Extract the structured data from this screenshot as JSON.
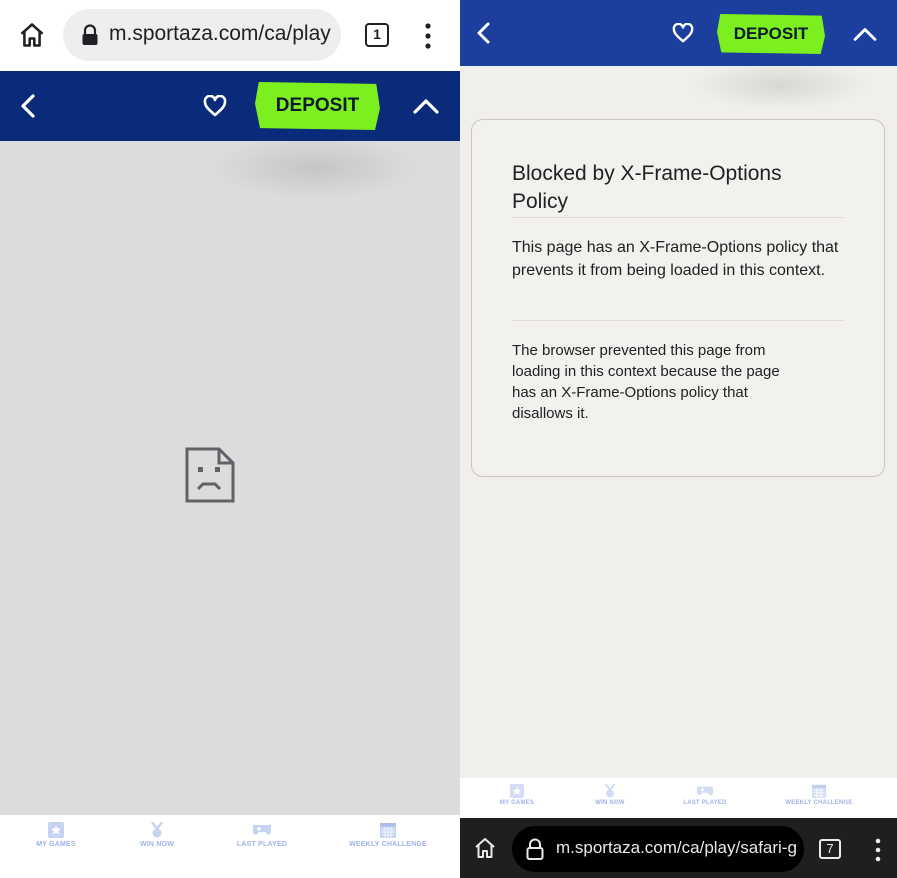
{
  "left": {
    "browser": {
      "url": "m.sportaza.com/ca/play",
      "tab_count": "1"
    },
    "header": {
      "deposit_label": "DEPOSIT"
    },
    "bottom_nav": [
      {
        "label": "MY GAMES",
        "icon": "star-icon"
      },
      {
        "label": "WIN NOW",
        "icon": "medal-icon"
      },
      {
        "label": "LAST PLAYED",
        "icon": "gamepad-icon"
      },
      {
        "label": "WEEKLY CHALLENGE",
        "icon": "calendar-icon"
      }
    ]
  },
  "right": {
    "header": {
      "deposit_label": "DEPOSIT"
    },
    "error": {
      "title": "Blocked by X-Frame-Options Policy",
      "message": "This page has an X-Frame-Options policy that prevents it from being loaded in this context.",
      "details": "The browser prevented this page from loading in this context because the page has an X-Frame-Options policy that disallows it."
    },
    "bottom_nav": [
      {
        "label": "MY GAMES",
        "icon": "star-icon"
      },
      {
        "label": "WIN NOW",
        "icon": "medal-icon"
      },
      {
        "label": "LAST PLAYED",
        "icon": "gamepad-icon"
      },
      {
        "label": "WEEKLY CHALLENGE",
        "icon": "calendar-icon"
      }
    ],
    "browser": {
      "url": "m.sportaza.com/ca/play/safari-g",
      "tab_count": "7"
    }
  },
  "colors": {
    "header_dark": "#0a2a7a",
    "header_light": "#1c3f9e",
    "deposit_green": "#7cf01e",
    "nav_label": "#9fb3e8"
  }
}
